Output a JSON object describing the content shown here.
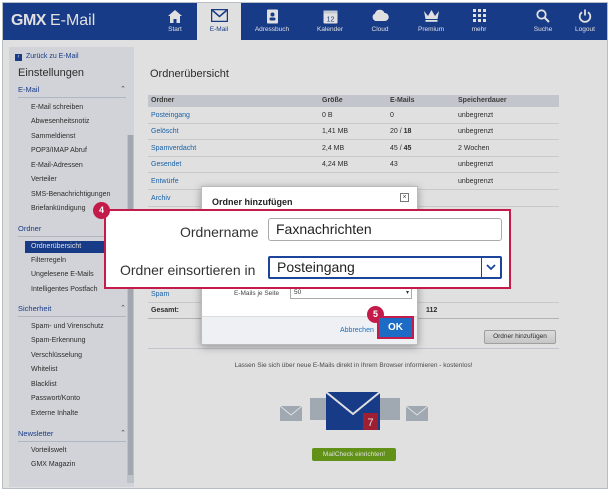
{
  "header": {
    "logo": "GMX",
    "app": "E-Mail",
    "nav": [
      {
        "label": "Start"
      },
      {
        "label": "E-Mail"
      },
      {
        "label": "Adressbuch"
      },
      {
        "label": "Kalender",
        "icon_text": "12"
      },
      {
        "label": "Cloud"
      },
      {
        "label": "Premium"
      },
      {
        "label": "mehr"
      },
      {
        "label": "Suche"
      },
      {
        "label": "Logout"
      }
    ]
  },
  "sidebar": {
    "back": "Zurück zu E-Mail",
    "title": "Einstellungen",
    "sections": [
      {
        "label": "E-Mail",
        "items": [
          "E-Mail schreiben",
          "Abwesenheitsnotiz",
          "Sammeldienst",
          "POP3/IMAP Abruf",
          "E-Mail-Adressen",
          "Verteiler",
          "SMS-Benachrichtigungen",
          "Briefankündigung"
        ]
      },
      {
        "label": "Ordner",
        "items": [
          "Ordnerübersicht",
          "Filterregeln",
          "Ungelesene E-Mails",
          "Intelligentes Postfach"
        ]
      },
      {
        "label": "Sicherheit",
        "items": [
          "Spam- und Virenschutz",
          "Spam-Erkennung",
          "Verschlüsselung",
          "Whitelist",
          "Blacklist",
          "Passwort/Konto",
          "Externe Inhalte"
        ]
      },
      {
        "label": "Newsletter",
        "items": [
          "Vorteilswelt",
          "GMX Magazin"
        ]
      }
    ]
  },
  "main": {
    "title": "Ordnerübersicht",
    "columns": [
      "Ordner",
      "Größe",
      "E-Mails",
      "Speicherdauer"
    ],
    "rows": [
      {
        "name": "Posteingang",
        "size": "0 B",
        "mails": "0",
        "mails_bold": "",
        "duration": "unbegrenzt"
      },
      {
        "name": "Gelöscht",
        "size": "1,41 MB",
        "mails": "20 / ",
        "mails_bold": "18",
        "duration": "unbegrenzt"
      },
      {
        "name": "Spamverdacht",
        "size": "2,4 MB",
        "mails": "45 / ",
        "mails_bold": "45",
        "duration": "2 Wochen"
      },
      {
        "name": "Gesendet",
        "size": "4,24 MB",
        "mails": "43",
        "mails_bold": "",
        "duration": "unbegrenzt"
      },
      {
        "name": "Entwürfe",
        "size": "",
        "mails": "",
        "mails_bold": "",
        "duration": "unbegrenzt"
      },
      {
        "name": "Archiv",
        "size": "",
        "mails": "",
        "mails_bold": "",
        "duration": ""
      }
    ],
    "spam_row": "Spam",
    "total_label": "Gesamt:",
    "total_partial": "112",
    "add_folder_button": "Ordner hinzufügen",
    "info_text": "Lassen Sie sich über neue E-Mails direkt in Ihrem Browser informieren - kostenlos!",
    "envelope_badge": "7",
    "mailcheck_button": "MailCheck einrichten!"
  },
  "dialog": {
    "title": "Ordner hinzufügen",
    "folder_name_label": "Ordnername",
    "folder_name_value": "Faxnachrichten",
    "sort_label": "Ordner einsortieren in",
    "sort_value": "Posteingang",
    "per_page_label": "E-Mails je Seite",
    "per_page_value": "50",
    "cancel": "Abbrechen",
    "ok": "OK"
  },
  "callouts": {
    "step4": "4",
    "step5": "5"
  },
  "colors": {
    "brand": "#1c449b",
    "callout": "#c31c4a",
    "ok_button": "#1c6bc4",
    "mailcheck": "#6fa51b"
  }
}
